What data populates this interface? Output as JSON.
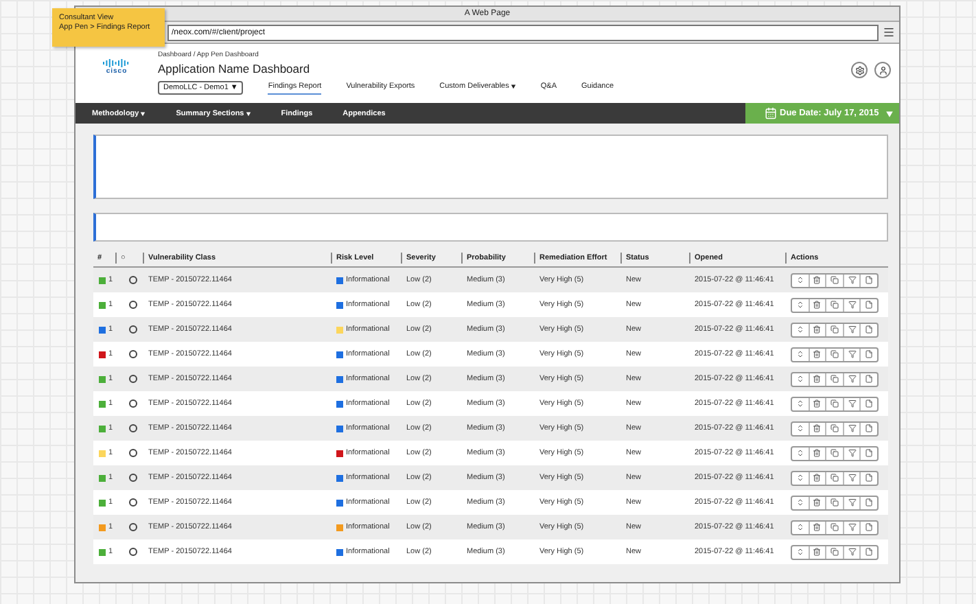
{
  "note": {
    "lines": [
      "Consultant View",
      "App Pen > Findings Report"
    ]
  },
  "window": {
    "title": "A Web Page",
    "url": "/neox.com/#/client/project"
  },
  "header": {
    "logo_text": "cisco",
    "breadcrumb": "Dashboard / App Pen Dashboard",
    "title": "Application Name Dashboard",
    "client_select": "DemoLLC - Demo1 ▼",
    "tabs": [
      {
        "label": "Findings Report",
        "selected": true,
        "dropdown": false
      },
      {
        "label": "Vulnerability Exports",
        "selected": false,
        "dropdown": false
      },
      {
        "label": "Custom Deliverables",
        "selected": false,
        "dropdown": true
      },
      {
        "label": "Q&A",
        "selected": false,
        "dropdown": false
      },
      {
        "label": "Guidance",
        "selected": false,
        "dropdown": false
      }
    ]
  },
  "nav": {
    "items": [
      {
        "label": "Methodology",
        "dropdown": true
      },
      {
        "label": "Summary Sections",
        "dropdown": true
      },
      {
        "label": "Findings",
        "dropdown": false
      },
      {
        "label": "Appendices",
        "dropdown": false
      }
    ],
    "due_date": "Due Date: July 17, 2015"
  },
  "table": {
    "columns": [
      "#",
      "○",
      "Vulnerability Class",
      "Risk Level",
      "Severity",
      "Probability",
      "Remediation Effort",
      "Status",
      "Opened",
      "Actions"
    ],
    "rows": [
      {
        "flag": {
          "color": "#4caf3a"
        },
        "number": "1",
        "selected": false,
        "vulnerability_class": "TEMP - 20150722.11464",
        "risk": {
          "color": "#1e6fe0",
          "label": "Informational"
        },
        "severity": "Low (2)",
        "probability": "Medium (3)",
        "remediation_effort": "Very High (5)",
        "status": "New",
        "opened": "2015-07-22 @ 11:46:41"
      },
      {
        "flag": {
          "color": "#4caf3a"
        },
        "number": "1",
        "selected": false,
        "vulnerability_class": "TEMP - 20150722.11464",
        "risk": {
          "color": "#1e6fe0",
          "label": "Informational"
        },
        "severity": "Low (2)",
        "probability": "Medium (3)",
        "remediation_effort": "Very High (5)",
        "status": "New",
        "opened": "2015-07-22 @ 11:46:41"
      },
      {
        "flag": {
          "color": "#1e6fe0"
        },
        "number": "1",
        "selected": false,
        "vulnerability_class": "TEMP - 20150722.11464",
        "risk": {
          "color": "#fcd65c",
          "label": "Informational"
        },
        "severity": "Low (2)",
        "probability": "Medium (3)",
        "remediation_effort": "Very High (5)",
        "status": "New",
        "opened": "2015-07-22 @ 11:46:41"
      },
      {
        "flag": {
          "color": "#d0161b"
        },
        "number": "1",
        "selected": false,
        "vulnerability_class": "TEMP - 20150722.11464",
        "risk": {
          "color": "#1e6fe0",
          "label": "Informational"
        },
        "severity": "Low (2)",
        "probability": "Medium (3)",
        "remediation_effort": "Very High (5)",
        "status": "New",
        "opened": "2015-07-22 @ 11:46:41"
      },
      {
        "flag": {
          "color": "#4caf3a"
        },
        "number": "1",
        "selected": false,
        "vulnerability_class": "TEMP - 20150722.11464",
        "risk": {
          "color": "#1e6fe0",
          "label": "Informational"
        },
        "severity": "Low (2)",
        "probability": "Medium (3)",
        "remediation_effort": "Very High (5)",
        "status": "New",
        "opened": "2015-07-22 @ 11:46:41"
      },
      {
        "flag": {
          "color": "#4caf3a"
        },
        "number": "1",
        "selected": false,
        "vulnerability_class": "TEMP - 20150722.11464",
        "risk": {
          "color": "#1e6fe0",
          "label": "Informational"
        },
        "severity": "Low (2)",
        "probability": "Medium (3)",
        "remediation_effort": "Very High (5)",
        "status": "New",
        "opened": "2015-07-22 @ 11:46:41"
      },
      {
        "flag": {
          "color": "#4caf3a"
        },
        "number": "1",
        "selected": false,
        "vulnerability_class": "TEMP - 20150722.11464",
        "risk": {
          "color": "#1e6fe0",
          "label": "Informational"
        },
        "severity": "Low (2)",
        "probability": "Medium (3)",
        "remediation_effort": "Very High (5)",
        "status": "New",
        "opened": "2015-07-22 @ 11:46:41"
      },
      {
        "flag": {
          "color": "#fcd65c"
        },
        "number": "1",
        "selected": false,
        "vulnerability_class": "TEMP - 20150722.11464",
        "risk": {
          "color": "#d0161b",
          "label": "Informational"
        },
        "severity": "Low (2)",
        "probability": "Medium (3)",
        "remediation_effort": "Very High (5)",
        "status": "New",
        "opened": "2015-07-22 @ 11:46:41"
      },
      {
        "flag": {
          "color": "#4caf3a"
        },
        "number": "1",
        "selected": false,
        "vulnerability_class": "TEMP - 20150722.11464",
        "risk": {
          "color": "#1e6fe0",
          "label": "Informational"
        },
        "severity": "Low (2)",
        "probability": "Medium (3)",
        "remediation_effort": "Very High (5)",
        "status": "New",
        "opened": "2015-07-22 @ 11:46:41"
      },
      {
        "flag": {
          "color": "#4caf3a"
        },
        "number": "1",
        "selected": false,
        "vulnerability_class": "TEMP - 20150722.11464",
        "risk": {
          "color": "#1e6fe0",
          "label": "Informational"
        },
        "severity": "Low (2)",
        "probability": "Medium (3)",
        "remediation_effort": "Very High (5)",
        "status": "New",
        "opened": "2015-07-22 @ 11:46:41"
      },
      {
        "flag": {
          "color": "#f39a1e"
        },
        "number": "1",
        "selected": false,
        "vulnerability_class": "TEMP - 20150722.11464",
        "risk": {
          "color": "#f39a1e",
          "label": "Informational"
        },
        "severity": "Low (2)",
        "probability": "Medium (3)",
        "remediation_effort": "Very High (5)",
        "status": "New",
        "opened": "2015-07-22 @ 11:46:41"
      },
      {
        "flag": {
          "color": "#4caf3a"
        },
        "number": "1",
        "selected": false,
        "vulnerability_class": "TEMP - 20150722.11464",
        "risk": {
          "color": "#1e6fe0",
          "label": "Informational"
        },
        "severity": "Low (2)",
        "probability": "Medium (3)",
        "remediation_effort": "Very High (5)",
        "status": "New",
        "opened": "2015-07-22 @ 11:46:41"
      }
    ]
  }
}
